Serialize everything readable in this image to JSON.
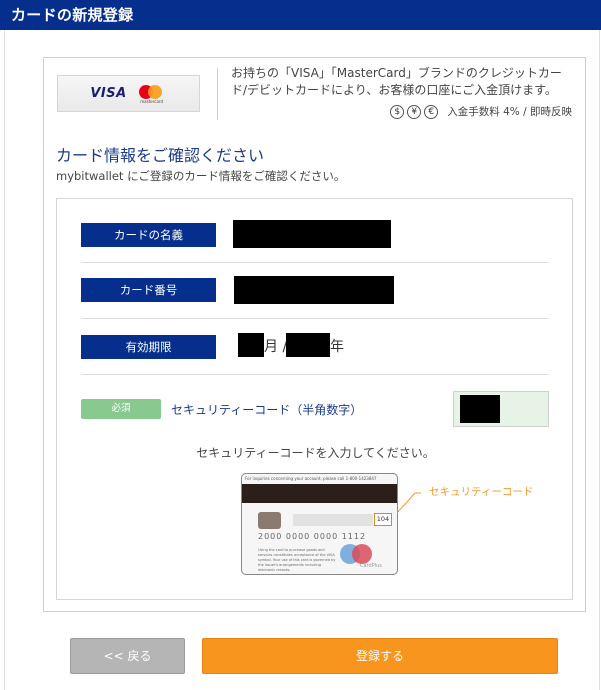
{
  "header": {
    "title": "カードの新規登録"
  },
  "card_brands": {
    "visa": "VISA",
    "mastercard": "mastercard"
  },
  "info": {
    "text": "お持ちの「VISA」「MasterCard」ブランドのクレジットカード/デビットカードにより、お客様の口座にご入金頂けます。",
    "currency_icons": [
      "$",
      "¥",
      "€"
    ],
    "fee": "入金手数料 4% / 即時反映"
  },
  "section": {
    "title": "カード情報をご確認ください",
    "description": "mybitwallet にご登録のカード情報をご確認ください。"
  },
  "fields": {
    "card_name_label": "カードの名義",
    "card_number_label": "カード番号",
    "expiry_label": "有効期限",
    "expiry_month_suffix": "月 /",
    "expiry_year_suffix": "年"
  },
  "security": {
    "required_badge": "必須",
    "label": "セキュリティーコード（半角数字）",
    "hint": "セキュリティーコードを入力してください。",
    "callout": "セキュリティーコード",
    "sample_code": "104"
  },
  "card_illustration": {
    "top_text": "For inquiries concerning your account, please call 1-800-1423847",
    "number_text": "2000 0000 0000 1112",
    "small_text": "Using the card to purchase goods and services constitutes acceptance of the VISA symbol. Your use of this card is governed by the issuer's arrangements including electronic records.",
    "brand": "CardPlus"
  },
  "buttons": {
    "back": "<< 戻る",
    "submit": "登録する"
  }
}
